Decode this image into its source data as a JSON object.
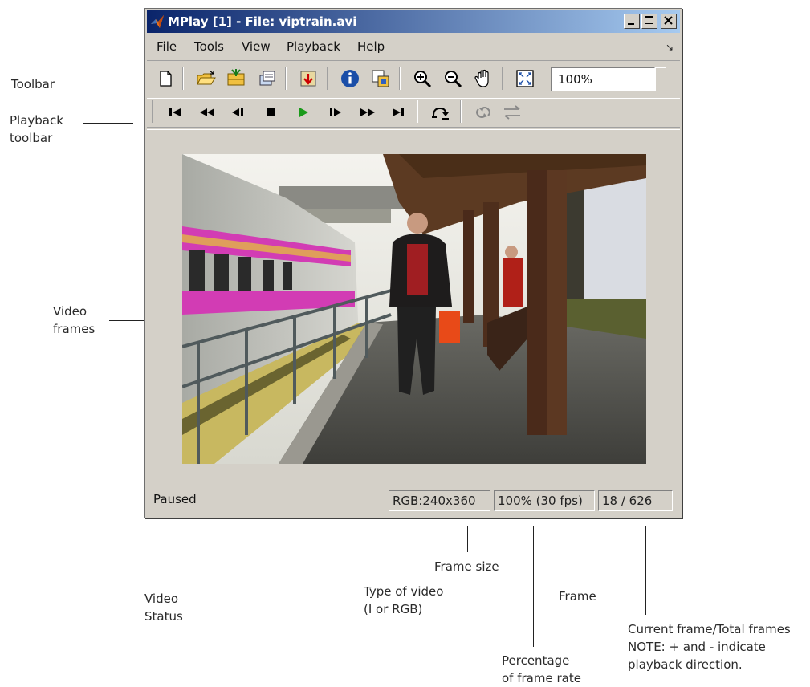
{
  "window": {
    "title": "MPlay [1] - File: viptrain.avi"
  },
  "menu": [
    "File",
    "Tools",
    "View",
    "Playback",
    "Help"
  ],
  "toolbar": {
    "zoom_value": "100%"
  },
  "status": {
    "state": "Paused",
    "video_type_size": "RGB:240x360",
    "frame_rate": "100% (30 fps)",
    "frame_count": "18 / 626"
  },
  "callouts": {
    "toolbar": "Toolbar",
    "playback_toolbar": "Playback\ntoolbar",
    "video_frames": "Video\nframes",
    "video_status": "Video\nStatus",
    "type_of_video": "Type of video\n(I or RGB)",
    "frame_size": "Frame size",
    "frame": "Frame",
    "percentage": "Percentage\nof frame rate",
    "current_frame": "Current frame/Total frames\nNOTE: + and - indicate\nplayback direction."
  },
  "colors": {
    "title_gradient_start": "#0a246a",
    "title_gradient_end": "#a6caf0",
    "window_face": "#d4d0c8",
    "play_green": "#1a9a1a"
  },
  "icons": {
    "toolbar": [
      "new-document-icon",
      "open-folder-icon",
      "import-icon",
      "export-icon",
      "jump-to-icon",
      "info-icon",
      "colormap-icon",
      "zoom-in-icon",
      "zoom-out-icon",
      "pan-hand-icon",
      "fit-to-view-icon"
    ],
    "playback": [
      "go-to-first-icon",
      "rewind-icon",
      "step-back-icon",
      "stop-icon",
      "play-icon",
      "step-forward-icon",
      "fast-forward-icon",
      "go-to-last-icon",
      "jump-to-frame-icon",
      "auto-reverse-icon",
      "playback-direction-icon"
    ]
  }
}
